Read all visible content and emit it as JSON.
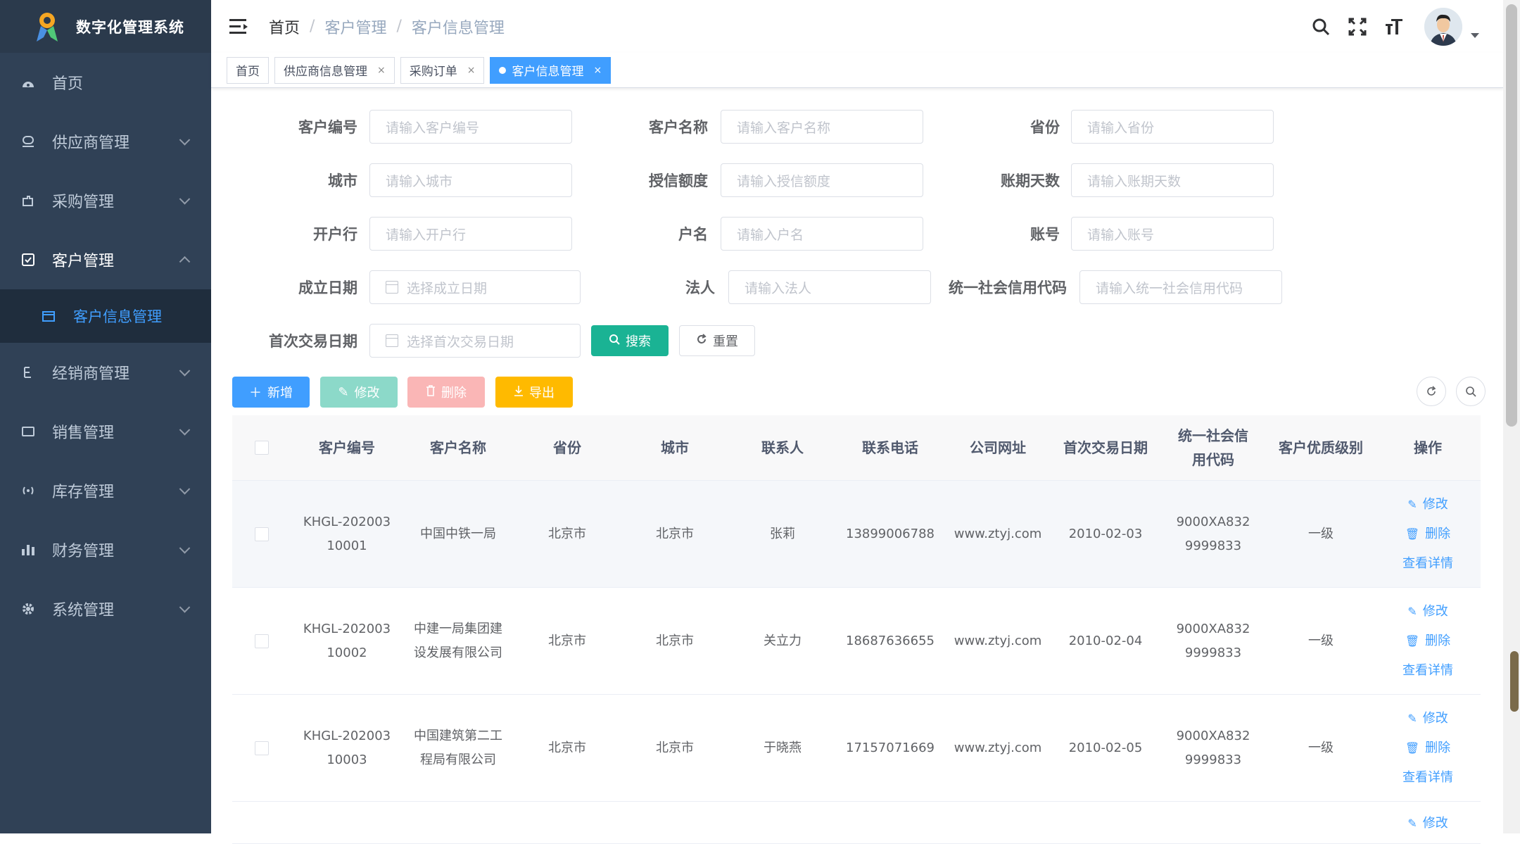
{
  "app": {
    "title": "数字化管理系统"
  },
  "sidebar": {
    "items": [
      {
        "label": "首页",
        "icon": "dashboard-icon"
      },
      {
        "label": "供应商管理",
        "icon": "supplier-icon"
      },
      {
        "label": "采购管理",
        "icon": "purchase-icon"
      },
      {
        "label": "客户管理",
        "icon": "checkbox-icon"
      },
      {
        "label": "经销商管理",
        "icon": "dealer-icon"
      },
      {
        "label": "销售管理",
        "icon": "sales-icon"
      },
      {
        "label": "库存管理",
        "icon": "inventory-icon"
      },
      {
        "label": "财务管理",
        "icon": "finance-icon"
      },
      {
        "label": "系统管理",
        "icon": "gear-icon"
      }
    ],
    "sub_item": {
      "label": "客户信息管理",
      "icon": "calendar-icon"
    }
  },
  "breadcrumb": {
    "items": [
      "首页",
      "客户管理",
      "客户信息管理"
    ],
    "sep": "/"
  },
  "tags": {
    "items": [
      {
        "label": "首页"
      },
      {
        "label": "供应商信息管理"
      },
      {
        "label": "采购订单"
      },
      {
        "label": "客户信息管理"
      }
    ],
    "close": "×"
  },
  "form": {
    "fields": [
      {
        "label": "客户编号",
        "placeholder": "请输入客户编号"
      },
      {
        "label": "客户名称",
        "placeholder": "请输入客户名称"
      },
      {
        "label": "省份",
        "placeholder": "请输入省份"
      },
      {
        "label": "城市",
        "placeholder": "请输入城市"
      },
      {
        "label": "授信额度",
        "placeholder": "请输入授信额度"
      },
      {
        "label": "账期天数",
        "placeholder": "请输入账期天数"
      },
      {
        "label": "开户行",
        "placeholder": "请输入开户行"
      },
      {
        "label": "户名",
        "placeholder": "请输入户名"
      },
      {
        "label": "账号",
        "placeholder": "请输入账号"
      },
      {
        "label": "成立日期",
        "placeholder": "选择成立日期"
      },
      {
        "label": "法人",
        "placeholder": "请输入法人"
      },
      {
        "label": "统一社会信用代码",
        "placeholder": "请输入统一社会信用代码"
      },
      {
        "label": "首次交易日期",
        "placeholder": "选择首次交易日期"
      }
    ],
    "search_label": "搜索",
    "reset_label": "重置"
  },
  "toolbar": {
    "add_label": "新增",
    "edit_label": "修改",
    "delete_label": "删除",
    "export_label": "导出",
    "colors": {
      "primary": "#409eff",
      "success": "#1ab394",
      "warning": "#ffba00",
      "danger": "#f56c6c"
    }
  },
  "table": {
    "headers": [
      "客户编号",
      "客户名称",
      "省份",
      "城市",
      "联系人",
      "联系电话",
      "公司网址",
      "首次交易日期",
      "统一社会信用代码",
      "客户优质级别",
      "操作"
    ],
    "rows": [
      {
        "code": "KHGL-20200310001",
        "name": "中国中铁一局",
        "province": "北京市",
        "city": "北京市",
        "contact": "张莉",
        "phone": "13899006788",
        "website": "www.ztyj.com",
        "first_date": "2010-02-03",
        "credit_code": "9000XA8329999833",
        "level": "一级"
      },
      {
        "code": "KHGL-20200310002",
        "name": "中建一局集团建设发展有限公司",
        "province": "北京市",
        "city": "北京市",
        "contact": "关立力",
        "phone": "18687636655",
        "website": "www.ztyj.com",
        "first_date": "2010-02-04",
        "credit_code": "9000XA8329999833",
        "level": "一级"
      },
      {
        "code": "KHGL-20200310003",
        "name": "中国建筑第二工程局有限公司",
        "province": "北京市",
        "city": "北京市",
        "contact": "于晓燕",
        "phone": "17157071669",
        "website": "www.ztyj.com",
        "first_date": "2010-02-05",
        "credit_code": "9000XA8329999833",
        "level": "一级"
      }
    ],
    "ops": {
      "edit": "修改",
      "delete": "删除",
      "detail": "查看详情"
    }
  }
}
